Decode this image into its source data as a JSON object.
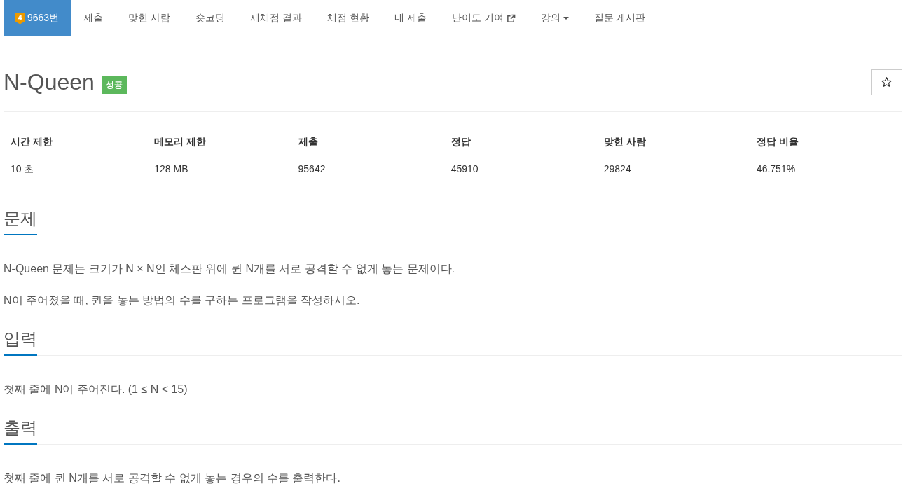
{
  "nav": {
    "problem": {
      "tier": "4",
      "label": "9663번",
      "selected": true
    },
    "items": [
      {
        "label": "제출",
        "kind": "link",
        "selected": false
      },
      {
        "label": "맞힌 사람",
        "kind": "link",
        "selected": false
      },
      {
        "label": "숏코딩",
        "kind": "link",
        "selected": false
      },
      {
        "label": "재채점 결과",
        "kind": "link",
        "selected": false
      },
      {
        "label": "채점 현황",
        "kind": "link",
        "selected": false
      },
      {
        "label": "내 제출",
        "kind": "link",
        "selected": false
      },
      {
        "label": "난이도 기여",
        "kind": "external",
        "selected": false
      },
      {
        "label": "강의",
        "kind": "dropdown",
        "selected": false
      },
      {
        "label": "질문 게시판",
        "kind": "link",
        "selected": false
      }
    ]
  },
  "title": "N-Queen",
  "result_badge": "성공",
  "star_button": {
    "starred": false
  },
  "info_table": {
    "columns": [
      "시간 제한",
      "메모리 제한",
      "제출",
      "정답",
      "맞힌 사람",
      "정답 비율"
    ],
    "rows": [
      [
        "10 초",
        "128 MB",
        "95642",
        "45910",
        "29824",
        "46.751%"
      ]
    ]
  },
  "sections": [
    {
      "title": "문제",
      "paragraphs": [
        "N-Queen 문제는 크기가 N × N인 체스판 위에 퀸 N개를 서로 공격할 수 없게 놓는 문제이다.",
        "N이 주어졌을 때, 퀸을 놓는 방법의 수를 구하는 프로그램을 작성하시오."
      ]
    },
    {
      "title": "입력",
      "paragraphs": [
        "첫째 줄에 N이 주어진다. (1 ≤ N < 15)"
      ]
    },
    {
      "title": "출력",
      "paragraphs": [
        "첫째 줄에 퀸 N개를 서로 공격할 수 없게 놓는 경우의 수를 출력한다."
      ]
    }
  ]
}
